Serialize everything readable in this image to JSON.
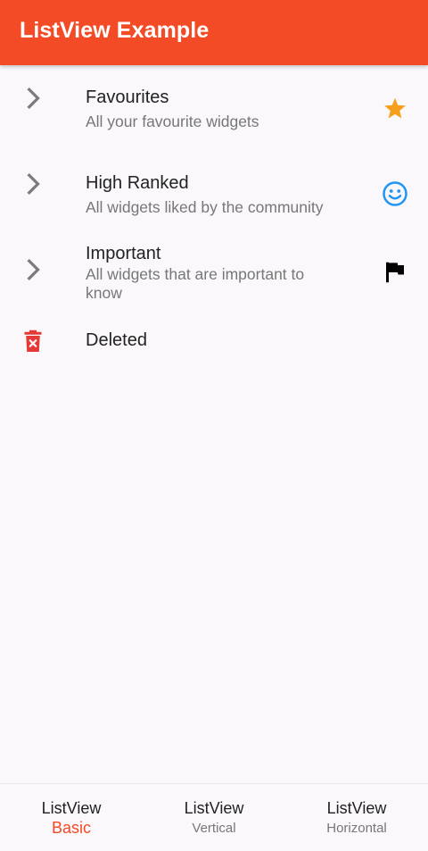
{
  "appbar": {
    "title": "ListView Example",
    "color": "#f34b25"
  },
  "list": {
    "items": [
      {
        "leading_icon": "chevron-right-icon",
        "title": "Favourites",
        "subtitle": "All your favourite widgets",
        "trailing_icon": "star-icon",
        "trailing_color": "#f5a01a"
      },
      {
        "leading_icon": "chevron-right-icon",
        "title": "High Ranked",
        "subtitle": "All widgets liked by the community",
        "trailing_icon": "smiley-face-icon",
        "trailing_color": "#2196f3"
      },
      {
        "leading_icon": "chevron-right-icon",
        "title": "Important",
        "subtitle": "All widgets that are important to know",
        "trailing_icon": "flag-icon",
        "trailing_color": "#000000"
      },
      {
        "leading_icon": "trash-delete-icon",
        "leading_color": "#e53935",
        "title": "Deleted"
      }
    ]
  },
  "bottom_nav": {
    "items": [
      {
        "label": "ListView",
        "sublabel": "Basic",
        "active": true
      },
      {
        "label": "ListView",
        "sublabel": "Vertical",
        "active": false
      },
      {
        "label": "ListView",
        "sublabel": "Horizontal",
        "active": false
      }
    ],
    "active_color": "#f34b25"
  }
}
